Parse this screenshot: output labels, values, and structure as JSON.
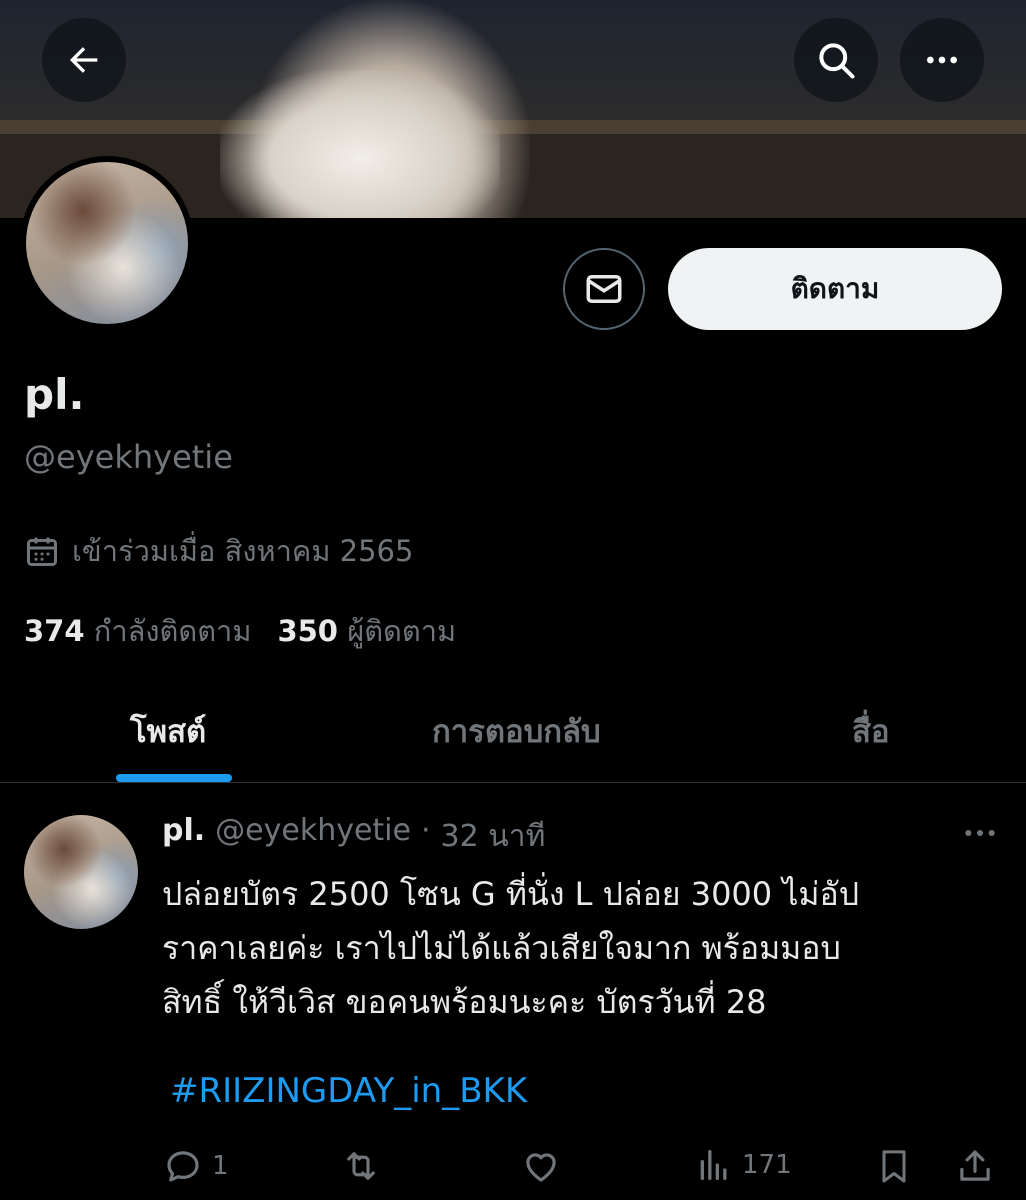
{
  "profile": {
    "display_name": "pl.",
    "handle": "@eyekhyetie",
    "joined": "เข้าร่วมเมื่อ สิงหาคม 2565",
    "following_count": "374",
    "following_label": "กำลังติดตาม",
    "followers_count": "350",
    "followers_label": "ผู้ติดตาม",
    "follow_button": "ติดตาม"
  },
  "tabs": [
    {
      "label": "โพสต์",
      "active": true
    },
    {
      "label": "การตอบกลับ",
      "active": false
    },
    {
      "label": "สื่อ",
      "active": false
    }
  ],
  "post": {
    "name": "pl.",
    "handle": "@eyekhyetie",
    "separator": "·",
    "time": "32 นาที",
    "lines": [
      "ปล่อยบัตร 2500 โซน G ที่นั่ง L ปล่อย 3000 ไม่อัป",
      "ราคาเลยค่ะ เราไปไม่ได้แล้วเสียใจมาก พร้อมมอบ",
      "สิทธิ์ ให้วีเวิส ขอคนพร้อมนะคะ บัตรวันที่ 28"
    ],
    "hashtag": "#RIIZINGDAY_in_BKK",
    "reply_count": "1",
    "view_count": "171"
  },
  "icons": [
    "back-arrow-icon",
    "search-icon",
    "more-icon",
    "mail-icon",
    "calendar-icon",
    "reply-icon",
    "retweet-icon",
    "like-icon",
    "views-icon",
    "bookmark-icon",
    "share-icon"
  ],
  "colors": {
    "accent": "#1d9bf0",
    "muted": "#71767b",
    "text": "#e7e9ea",
    "background": "#000000"
  }
}
